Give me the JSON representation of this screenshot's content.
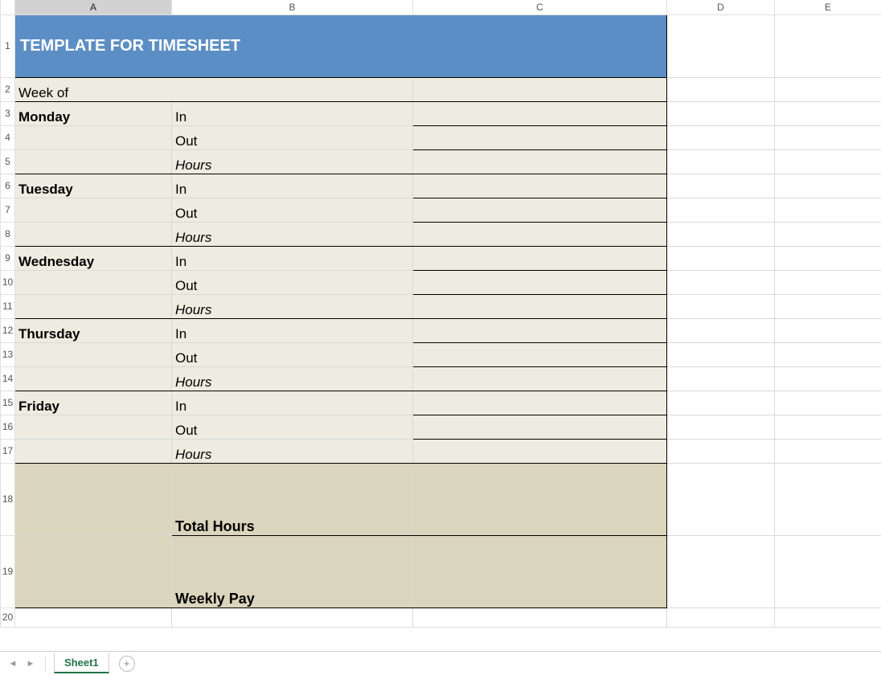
{
  "columns": {
    "A": "A",
    "B": "B",
    "C": "C",
    "D": "D",
    "E": "E"
  },
  "rows": [
    "1",
    "2",
    "3",
    "4",
    "5",
    "6",
    "7",
    "8",
    "9",
    "10",
    "11",
    "12",
    "13",
    "14",
    "15",
    "16",
    "17",
    "18",
    "19",
    "20"
  ],
  "title": "TEMPLATE FOR TIMESHEET",
  "labels": {
    "weekOf": "Week of",
    "in": "In",
    "out": "Out",
    "hours": "Hours",
    "totalHours": "Total Hours",
    "weeklyPay": "Weekly Pay"
  },
  "days": {
    "mon": "Monday",
    "tue": "Tuesday",
    "wed": "Wednesday",
    "thu": "Thursday",
    "fri": "Friday"
  },
  "tabs": {
    "sheet1": "Sheet1"
  }
}
